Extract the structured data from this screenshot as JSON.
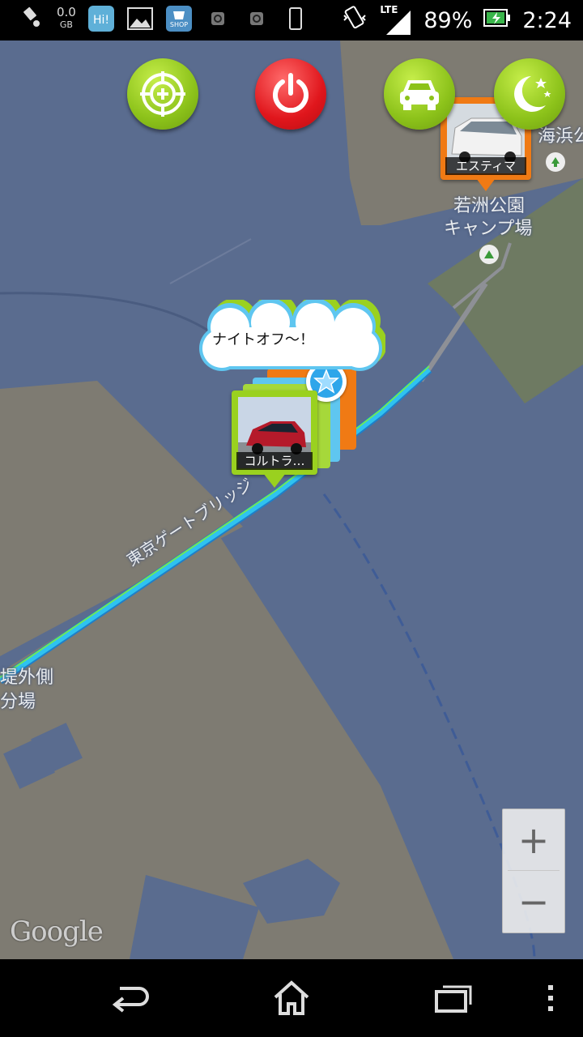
{
  "status_bar": {
    "data_usage": "0.0",
    "data_unit": "GB",
    "network": "LTE",
    "battery_percent": "89%",
    "time": "2:24",
    "icons": [
      "location-icon",
      "hi-app-icon",
      "gallery-icon",
      "shop-icon",
      "sync-icon",
      "sync-icon",
      "phone-icon",
      "vibrate-icon",
      "signal-icon",
      "battery-icon"
    ]
  },
  "toolbar": {
    "buttons": [
      "locate-target-icon",
      "power-icon",
      "car-icon",
      "night-mode-icon"
    ],
    "colors": {
      "green": "#8cc21a",
      "red": "#e0161c"
    }
  },
  "map": {
    "labels": {
      "bridge": "東京ゲートブリッジ",
      "park_line1": "若洲公園",
      "park_line2": "キャンプ場",
      "seaside": "海浜公",
      "left_line1": "堤外側",
      "left_line2": "分場"
    },
    "speech_bubble": "ナイトオフ～！",
    "pins": [
      {
        "caption": "エスティマ",
        "frame_color": "#f07a14"
      },
      {
        "caption": "コルトラ…",
        "frame_color": "#9ad11f"
      }
    ],
    "attribution": "Google",
    "colors": {
      "water": "#5a6c8f",
      "land": "#7e7b72",
      "park": "#6e7a62",
      "route": "#2fc2f0"
    }
  },
  "zoom": {
    "in": "+",
    "out": "−"
  },
  "nav": {
    "icons": [
      "back-icon",
      "home-icon",
      "recent-apps-icon",
      "menu-icon"
    ]
  }
}
